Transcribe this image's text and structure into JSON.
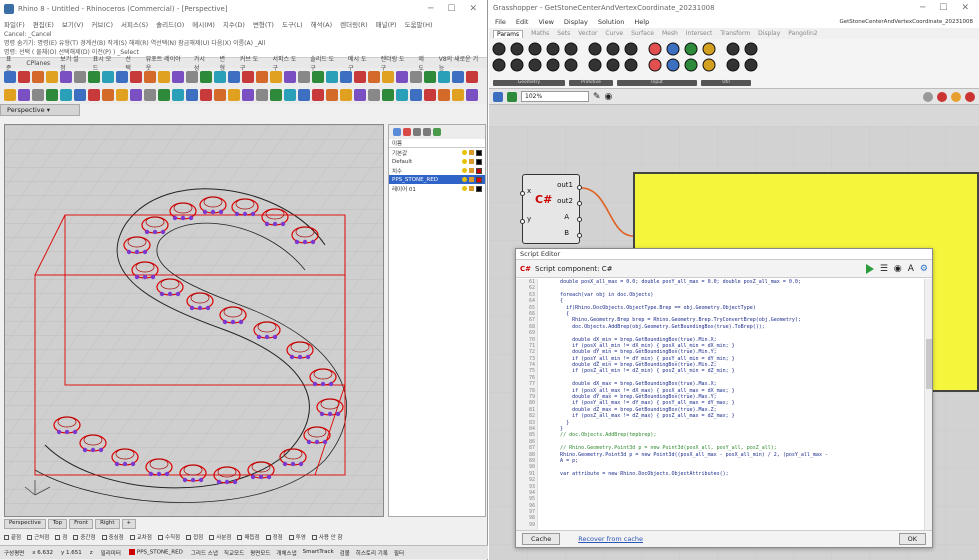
{
  "rhino": {
    "title": "Rhino 8 - Untitled - Rhinoceros (Commercial) - [Perspective]",
    "menu": [
      "파일(F)",
      "편집(E)",
      "보기(V)",
      "커브(C)",
      "서피스(S)",
      "솔리드(O)",
      "메시(M)",
      "치수(D)",
      "변형(T)",
      "도구(L)",
      "해석(A)",
      "렌더링(R)",
      "패널(P)",
      "도움말(H)"
    ],
    "command_lines": [
      "Cancel: _Cancel",
      "명령 숨기기: 명령(E) 유형(T) 경계선(B) 작게(S) 해제(R) 역선택(N) 잠금해제(U) 다음(X) 이름(A) _All",
      "명령: 선택 ( 물체(O) 선택해제(D) 이전(P) ) _Select"
    ],
    "tool_tabs": [
      "표준",
      "CPlanes",
      "보기 설정",
      "표시 모드",
      "선택",
      "뷰포트 레이아웃",
      "가시성",
      "변형",
      "커브 도구",
      "서피스 도구",
      "솔리드 도구",
      "메시 도구",
      "렌더링 도구",
      "제도",
      "V8의 새로운 기능"
    ],
    "viewport_label": "Perspective",
    "layers": {
      "header": "이름",
      "rows": [
        {
          "name": "기본값",
          "color": "#000000",
          "selected": false
        },
        {
          "name": "Default",
          "color": "#000000",
          "selected": false
        },
        {
          "name": "치수",
          "color": "#c00000",
          "selected": false
        },
        {
          "name": "PPS_STONE_RED",
          "color": "#e00000",
          "selected": true
        },
        {
          "name": "레이어 01",
          "color": "#000000",
          "selected": false
        }
      ]
    },
    "viewport_tabs": [
      "Perspective",
      "Top",
      "Front",
      "Right",
      "+"
    ],
    "osnaps": [
      "끝점",
      "근처점",
      "점",
      "중간점",
      "중심점",
      "교차점",
      "수직점",
      "접점",
      "사분점",
      "매듭점",
      "정점",
      "투영",
      "사용 안 함"
    ],
    "status": {
      "cplane": "구성평면",
      "x": "x 6.632",
      "y": "y 1.651",
      "z": "z",
      "units": "밀리미터",
      "layer": "PPS_STONE_RED",
      "items": [
        "그리드 스냅",
        "직교모드",
        "평면모드",
        "개체스냅",
        "SmartTrack",
        "검볼",
        "히스토리 기록",
        "필터"
      ]
    }
  },
  "gh": {
    "title": "Grasshopper - GetStoneCenterAndVertexCoordinate_20231008",
    "menu": [
      "File",
      "Edit",
      "View",
      "Display",
      "Solution",
      "Help"
    ],
    "doc_name": "GetStoneCenterAndVertexCoordinate_20231008",
    "tabs": [
      "Params",
      "Maths",
      "Sets",
      "Vector",
      "Curve",
      "Surface",
      "Mesh",
      "Intersect",
      "Transform",
      "Display",
      "Pangolin2"
    ],
    "ribbon_groups": [
      "Geometry",
      "Primitive",
      "Input",
      "Util"
    ],
    "zoom": "102%",
    "component": {
      "inputs": [
        "x",
        "y"
      ],
      "outputs": [
        "out1",
        "out2",
        "A",
        "B"
      ]
    }
  },
  "script_editor": {
    "window_title": "Script Editor",
    "header": "Script component: C#",
    "line_numbers": [
      "61",
      "62",
      "63",
      "64",
      "65",
      "66",
      "67",
      "68",
      "69",
      "70",
      "71",
      "72",
      "73",
      "74",
      "75",
      "76",
      "77",
      "78",
      "79",
      "80",
      "81",
      "82",
      "83",
      "84",
      "85",
      "86",
      "87",
      "88",
      "89",
      "90",
      "91",
      "92",
      "93",
      "94",
      "95",
      "96",
      "97",
      "98",
      "99"
    ],
    "code_lines": [
      "      double posX_all_max = 0.0; double posY_all_max = 0.0; double posZ_all_max = 0.0;",
      "",
      "      foreach(var obj in doc.Objects)",
      "      {",
      "        if(Rhino.DocObjects.ObjectType.Brep == obj.Geometry.ObjectType)",
      "        {",
      "          Rhino.Geometry.Brep brep = Rhino.Geometry.Brep.TryConvertBrep(obj.Geometry);",
      "          doc.Objects.AddBrep(obj.Geometry.GetBoundingBox(true).ToBrep());",
      "",
      "          double dX_min = brep.GetBoundingBox(true).Min.X;",
      "          if (posX_all_min != dX_min) { posX_all_min = dX_min; }",
      "          double dY_min = brep.GetBoundingBox(true).Min.Y;",
      "          if (posY_all_min != dY_min) { posY_all_min = dY_min; }",
      "          double dZ_min = brep.GetBoundingBox(true).Min.Z;",
      "          if (posZ_all_min != dZ_min) { posZ_all_min = dZ_min; }",
      "",
      "          double dX_max = brep.GetBoundingBox(true).Max.X;",
      "          if (posX_all_max != dX_max) { posX_all_max = dX_max; }",
      "          double dY_max = brep.GetBoundingBox(true).Max.Y;",
      "          if (posY_all_max != dY_max) { posY_all_max = dY_max; }",
      "          double dZ_max = brep.GetBoundingBox(true).Max.Z;",
      "          if (posZ_all_max != dZ_max) { posZ_all_max = dZ_max; }",
      "        }",
      "      }",
      "      // doc.Objects.AddBrep(tmpbrep);",
      "",
      "      // Rhino.Geometry.Point3d p = new Point3d(posX_all, posY_all, posZ_all);",
      "      Rhino.Geometry.Point3d p = new Point3d((posX_all_max - posX_all_min) / 2, (posY_all_max -",
      "      A = p;",
      "",
      "      var attribute = new Rhino.DocObjects.ObjectAttributes();",
      "",
      "",
      "",
      "",
      "",
      "",
      "",
      ""
    ],
    "footer": {
      "cache": "Cache",
      "recover": "Recover from cache",
      "ok": "OK"
    }
  }
}
